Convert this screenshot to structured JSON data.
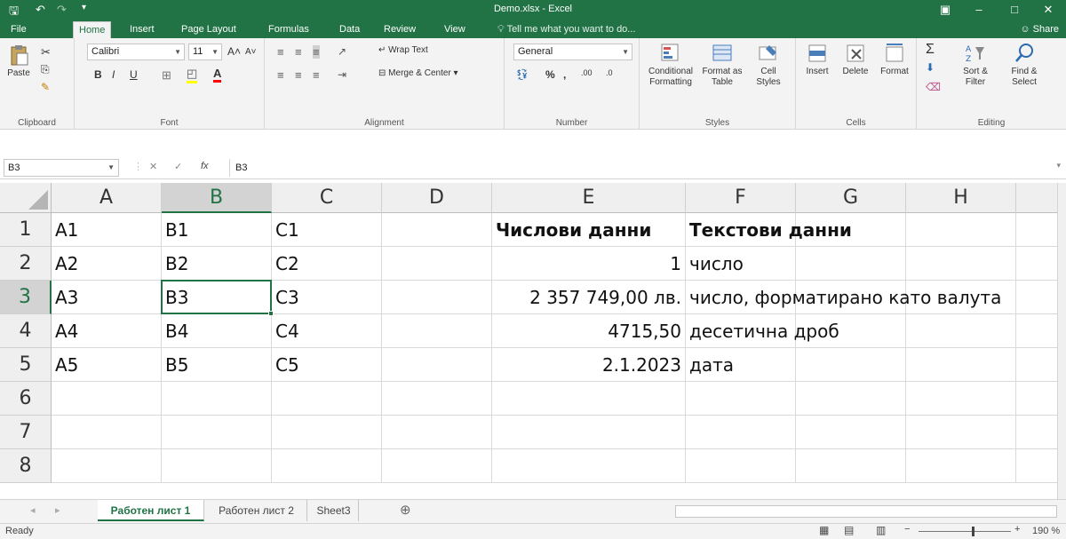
{
  "window": {
    "title": "Demo.xlsx - Excel",
    "save_icon": "save-icon",
    "undo_icon": "undo-icon",
    "redo_icon": "redo-icon"
  },
  "tabs": [
    "File",
    "Home",
    "Insert",
    "Page Layout",
    "Formulas",
    "Data",
    "Review",
    "View"
  ],
  "active_tab": "Home",
  "tell_me": "Tell me what you want to do...",
  "share_label": "Share",
  "ribbon": {
    "clipboard": {
      "label": "Clipboard",
      "paste": "Paste"
    },
    "font": {
      "label": "Font",
      "name": "Calibri",
      "size": "11",
      "bold": "B",
      "italic": "I",
      "underline": "U",
      "font_color_glyph": "A"
    },
    "alignment": {
      "label": "Alignment",
      "wrap": "Wrap Text",
      "merge": "Merge & Center"
    },
    "number": {
      "label": "Number",
      "format": "General",
      "percent": "%",
      "comma": ",",
      "inc_dec": ".00",
      "dec_dec": ".0"
    },
    "styles": {
      "label": "Styles",
      "conditional": "Conditional",
      "conditional2": "Formatting",
      "format_as": "Format as",
      "format_as2": "Table",
      "cell": "Cell",
      "cell2": "Styles"
    },
    "cells": {
      "label": "Cells",
      "insert": "Insert",
      "delete": "Delete",
      "format": "Format"
    },
    "editing": {
      "label": "Editing",
      "sort": "Sort &",
      "sort2": "Filter",
      "find": "Find &",
      "find2": "Select"
    }
  },
  "formula_bar": {
    "name_box": "B3",
    "fx": "fx",
    "content": "B3"
  },
  "columns": [
    "A",
    "B",
    "C",
    "D",
    "E",
    "F",
    "G",
    "H"
  ],
  "rows": [
    "1",
    "2",
    "3",
    "4",
    "5",
    "6",
    "7",
    "8"
  ],
  "cells": {
    "A1": "A1",
    "B1": "B1",
    "C1": "C1",
    "E1": "Числови данни",
    "F1": "Текстови данни",
    "A2": "A2",
    "B2": "B2",
    "C2": "C2",
    "E2": "1",
    "F2": "число",
    "A3": "A3",
    "B3": "B3",
    "C3": "C3",
    "E3": "2 357 749,00 лв.",
    "F3": "число, форматирано като валута",
    "A4": "A4",
    "B4": "B4",
    "C4": "C4",
    "E4": "4715,50",
    "F4": "десетична дроб",
    "A5": "A5",
    "B5": "B5",
    "C5": "C5",
    "E5": "2.1.2023",
    "F5": "дата"
  },
  "selected_cell": "B3",
  "sheets": [
    "Работен лист 1",
    "Работен лист 2",
    "Sheet3"
  ],
  "active_sheet": "Работен лист 1",
  "add_sheet_glyph": "⊕",
  "status": {
    "ready": "Ready",
    "zoom": "190 %"
  },
  "colors": {
    "accent": "#217346",
    "ribbon_bg": "#f3f3f3"
  }
}
